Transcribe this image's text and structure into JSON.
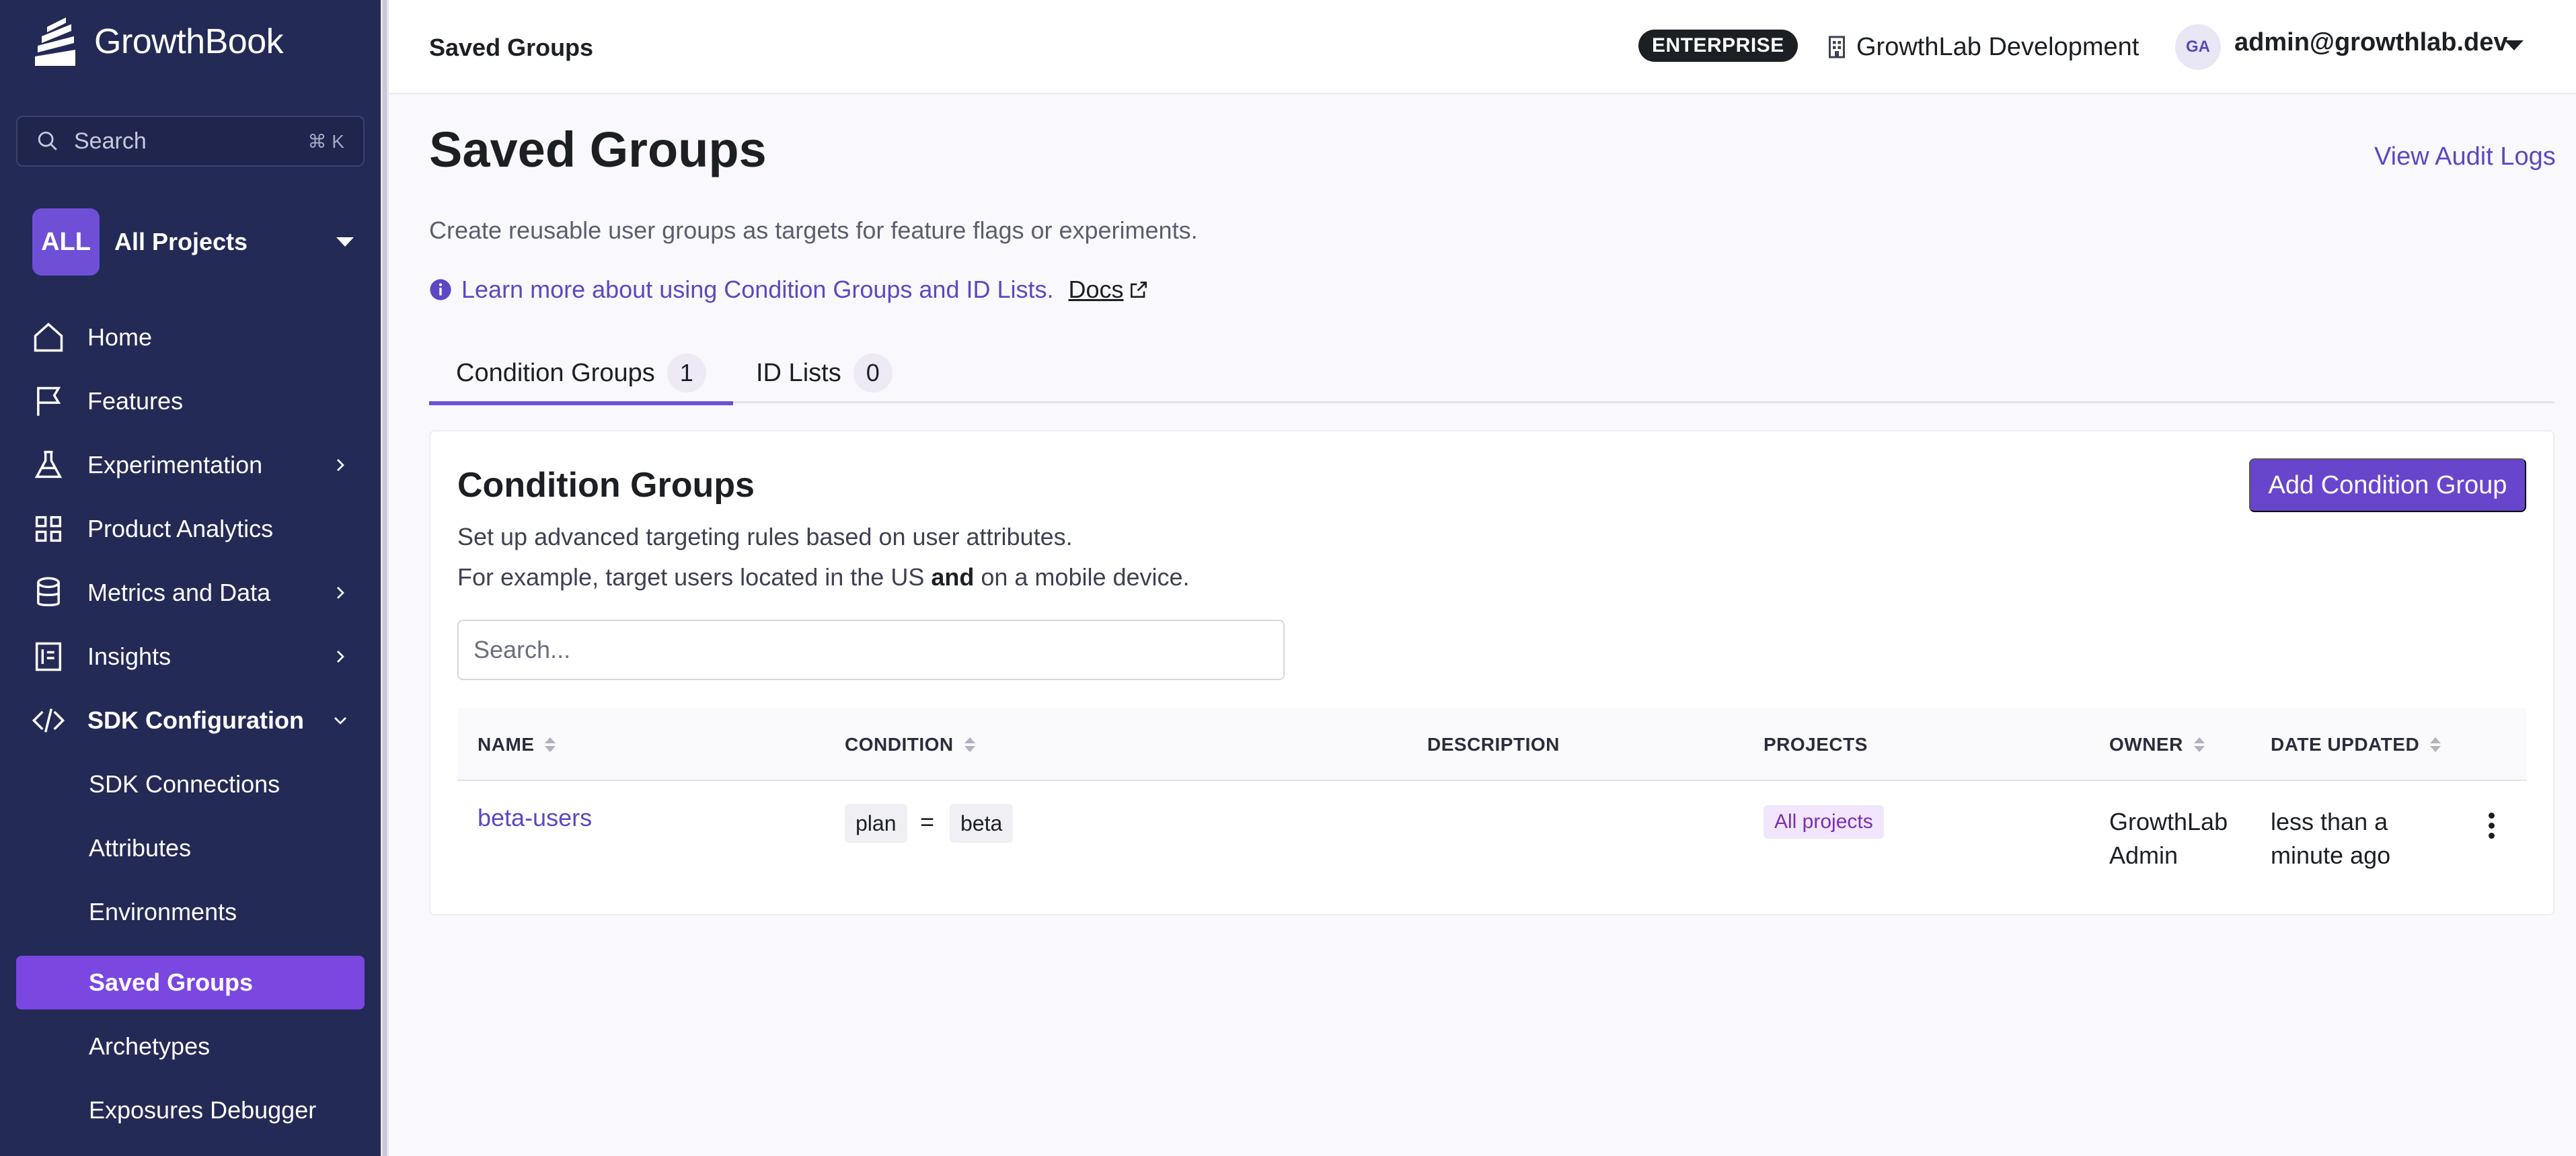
{
  "app": {
    "name": "GrowthBook"
  },
  "sidebar": {
    "search": {
      "label": "Search",
      "shortcut": "⌘ K"
    },
    "project": {
      "badge": "ALL",
      "name": "All Projects"
    },
    "items": [
      {
        "label": "Home",
        "icon": "home-icon"
      },
      {
        "label": "Features",
        "icon": "flag-icon"
      },
      {
        "label": "Experimentation",
        "icon": "flask-icon"
      },
      {
        "label": "Product Analytics",
        "icon": "grid-icon"
      },
      {
        "label": "Metrics and Data",
        "icon": "database-icon"
      },
      {
        "label": "Insights",
        "icon": "document-icon"
      },
      {
        "label": "SDK Configuration",
        "icon": "code-icon"
      }
    ],
    "sub_items": [
      {
        "label": "SDK Connections"
      },
      {
        "label": "Attributes"
      },
      {
        "label": "Environments"
      },
      {
        "label": "Saved Groups"
      },
      {
        "label": "Archetypes"
      },
      {
        "label": "Exposures Debugger"
      }
    ],
    "active_item": "Saved Groups"
  },
  "topbar": {
    "breadcrumb": "Saved Groups",
    "plan_badge": "ENTERPRISE",
    "org_name": "GrowthLab Development",
    "avatar_initials": "GA",
    "user_email": "admin@growthlab.dev"
  },
  "page": {
    "title": "Saved Groups",
    "audit_link": "View Audit Logs",
    "description": "Create reusable user groups as targets for feature flags or experiments.",
    "learn_more": "Learn more about using Condition Groups and ID Lists.",
    "docs_label": "Docs"
  },
  "tabs": [
    {
      "label": "Condition Groups",
      "count": "1",
      "active": true
    },
    {
      "label": "ID Lists",
      "count": "0",
      "active": false
    }
  ],
  "condition_groups": {
    "title": "Condition Groups",
    "add_button": "Add Condition Group",
    "description_line1": "Set up advanced targeting rules based on user attributes.",
    "description_line2_before": "For example, target users located in the US ",
    "description_line2_bold": "and",
    "description_line2_after": " on a mobile device.",
    "search_placeholder": "Search...",
    "columns": [
      "NAME",
      "CONDITION",
      "DESCRIPTION",
      "PROJECTS",
      "OWNER",
      "DATE UPDATED"
    ],
    "rows": [
      {
        "name": "beta-users",
        "condition": {
          "attribute": "plan",
          "operator": "=",
          "value": "beta"
        },
        "description": "",
        "projects": "All projects",
        "owner_line1": "GrowthLab",
        "owner_line2": "Admin",
        "updated_line1": "less than a",
        "updated_line2": "minute ago"
      }
    ]
  },
  "colors": {
    "sidebar_bg": "#232a56",
    "accent": "#6846cc",
    "active_nav": "#7a47e0",
    "link": "#5e47c2"
  }
}
